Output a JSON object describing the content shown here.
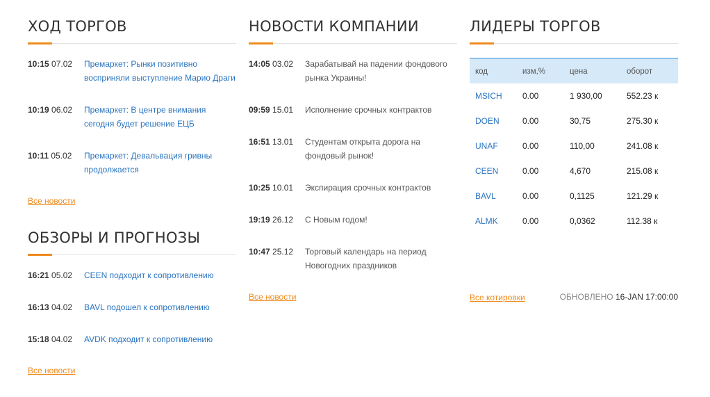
{
  "trading": {
    "title": "ХОД ТОРГОВ",
    "items": [
      {
        "time": "10:15",
        "date": "07.02",
        "text": "Премаркет: Рынки позитивно восприняли выступление Марио Драги"
      },
      {
        "time": "10:19",
        "date": "06.02",
        "text": "Премаркет: В центре внимания сегодня будет решение ЕЦБ"
      },
      {
        "time": "10:11",
        "date": "05.02",
        "text": "Премаркет: Девальвация гривны продолжается"
      }
    ],
    "all_link": "Все новости"
  },
  "reviews": {
    "title": "ОБЗОРЫ И ПРОГНОЗЫ",
    "items": [
      {
        "time": "16:21",
        "date": "05.02",
        "text": "CEEN подходит к сопротивлению"
      },
      {
        "time": "16:13",
        "date": "04.02",
        "text": "BAVL подошел к сопротивлению"
      },
      {
        "time": "15:18",
        "date": "04.02",
        "text": "AVDK подходит к сопротивлению"
      }
    ],
    "all_link": "Все новости"
  },
  "company_news": {
    "title": "НОВОСТИ КОМПАНИИ",
    "items": [
      {
        "time": "14:05",
        "date": "03.02",
        "text": "Зарабатывай на падении фондового рынка Украины!"
      },
      {
        "time": "09:59",
        "date": "15.01",
        "text": "Исполнение срочных контрактов"
      },
      {
        "time": "16:51",
        "date": "13.01",
        "text": "Студентам открыта дорога на фондовый рынок!"
      },
      {
        "time": "10:25",
        "date": "10.01",
        "text": "Экспирация срочных контрактов"
      },
      {
        "time": "19:19",
        "date": "26.12",
        "text": "С Новым годом!"
      },
      {
        "time": "10:47",
        "date": "25.12",
        "text": "Торговый календарь на период Новогодних праздников"
      }
    ],
    "all_link": "Все новости"
  },
  "leaders": {
    "title": "ЛИДЕРЫ ТОРГОВ",
    "columns": [
      "код",
      "изм,%",
      "цена",
      "оборот"
    ],
    "rows": [
      [
        "MSICH",
        "0.00",
        "1 930,00",
        "552.23 к"
      ],
      [
        "DOEN",
        "0.00",
        "30,75",
        "275.30 к"
      ],
      [
        "UNAF",
        "0.00",
        "110,00",
        "241.08 к"
      ],
      [
        "CEEN",
        "0.00",
        "4,670",
        "215.08 к"
      ],
      [
        "BAVL",
        "0.00",
        "0,1125",
        "121.29 к"
      ],
      [
        "ALMK",
        "0.00",
        "0,0362",
        "112.38 к"
      ]
    ],
    "all_link": "Все котировки",
    "updated_label": "ОБНОВЛЕНО",
    "updated_value": "16-JAN 17:00:00"
  },
  "colors": {
    "accent": "#f08a1c",
    "link": "#2a74c0",
    "table_header": "#d6e9f8"
  }
}
